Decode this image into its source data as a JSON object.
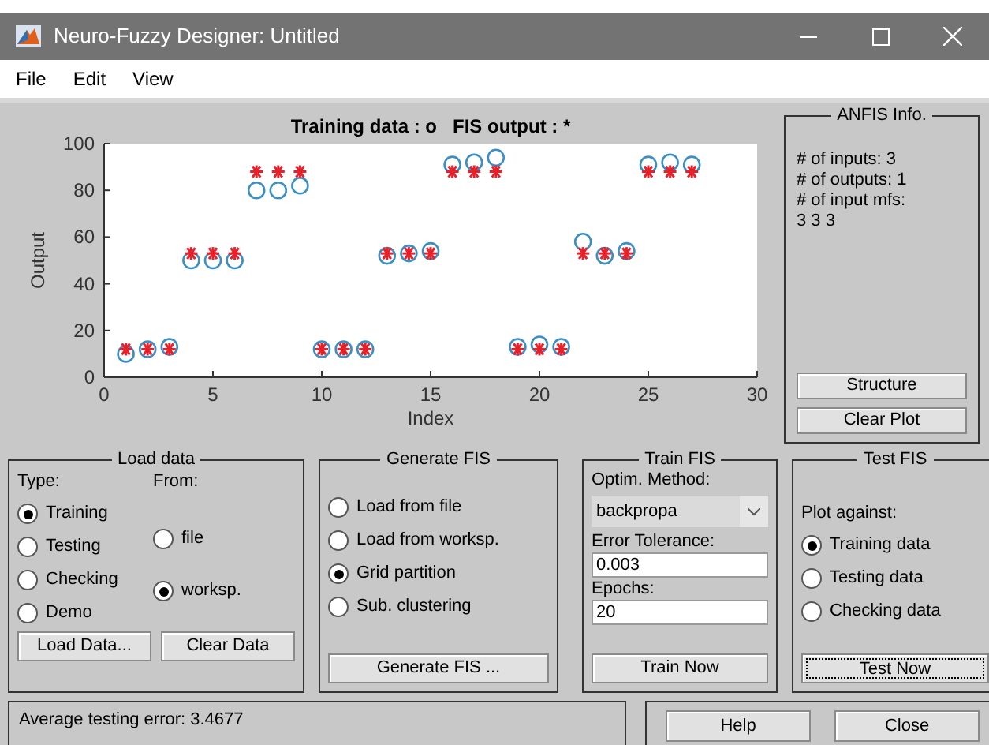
{
  "window": {
    "title": "Neuro-Fuzzy Designer: Untitled"
  },
  "menu": [
    {
      "label": "File"
    },
    {
      "label": "Edit"
    },
    {
      "label": "View"
    }
  ],
  "chart": {
    "key_marks": [
      ": o",
      ": *"
    ],
    "chart_data": {
      "type": "scatter",
      "xlabel": "Index",
      "ylabel": "Output",
      "xlim": [
        0,
        30
      ],
      "ylim": [
        0,
        100
      ],
      "xticks": [
        0,
        5,
        10,
        15,
        20,
        25,
        30
      ],
      "yticks": [
        0,
        20,
        40,
        60,
        80,
        100
      ],
      "x": [
        1,
        2,
        3,
        4,
        5,
        6,
        7,
        8,
        9,
        10,
        11,
        12,
        13,
        14,
        15,
        16,
        17,
        18,
        19,
        20,
        21,
        22,
        23,
        24,
        25,
        26,
        27
      ],
      "series": [
        {
          "name": "Training data",
          "color": "#3b8fc7",
          "marker": "circle",
          "values": [
            10,
            12,
            13,
            50,
            50,
            50,
            80,
            80,
            82,
            12,
            12,
            12,
            52,
            53,
            54,
            91,
            92,
            94,
            13,
            14,
            13,
            58,
            52,
            54,
            91,
            92,
            91
          ]
        },
        {
          "name": "FIS output",
          "color": "#e8202a",
          "marker": "cross",
          "values": [
            12,
            12,
            12,
            53,
            53,
            53,
            88,
            88,
            88,
            12,
            12,
            12,
            53,
            53,
            53,
            88,
            88,
            88,
            12,
            12,
            12,
            53,
            53,
            53,
            88,
            88,
            88
          ]
        }
      ]
    }
  },
  "anfis_info": {
    "title": "ANFIS Info.",
    "lines": [
      "# of inputs: 3",
      "# of outputs: 1",
      "# of input mfs:",
      "3 3 3"
    ],
    "buttons": [
      {
        "label": "Structure"
      },
      {
        "label": "Clear Plot"
      }
    ]
  },
  "load_data": {
    "title": "Load data",
    "type_label": "Type:",
    "from_label": "From:",
    "type_options": [
      {
        "label": "Training",
        "selected": true
      },
      {
        "label": "Testing",
        "selected": false
      },
      {
        "label": "Checking",
        "selected": false
      },
      {
        "label": "Demo",
        "selected": false
      }
    ],
    "from_options": [
      {
        "label": "file",
        "selected": false
      },
      {
        "label": "worksp.",
        "selected": true
      }
    ],
    "buttons": [
      {
        "label": "Load Data..."
      },
      {
        "label": "Clear Data"
      }
    ]
  },
  "generate_fis": {
    "title": "Generate FIS",
    "options": [
      {
        "label": "Load from file",
        "selected": false
      },
      {
        "label": "Load from worksp.",
        "selected": false
      },
      {
        "label": "Grid partition",
        "selected": true
      },
      {
        "label": "Sub. clustering",
        "selected": false
      }
    ],
    "button": {
      "label": "Generate FIS ..."
    }
  },
  "train_fis": {
    "title": "Train FIS",
    "method_label": "Optim. Method:",
    "method_value": "backpropa",
    "tolerance_label": "Error Tolerance:",
    "tolerance_value": "0.003",
    "epochs_label": "Epochs:",
    "epochs_value": "20",
    "button": {
      "label": "Train Now"
    }
  },
  "test_fis": {
    "title": "Test FIS",
    "plot_label": "Plot against:",
    "options": [
      {
        "label": "Training data",
        "selected": true
      },
      {
        "label": "Testing data",
        "selected": false
      },
      {
        "label": "Checking data",
        "selected": false
      }
    ],
    "button": {
      "label": "Test Now",
      "focused": true
    }
  },
  "status": {
    "message": "Average testing error: 3.4677"
  },
  "buttons": [
    {
      "label": "Help"
    },
    {
      "label": "Close"
    }
  ]
}
